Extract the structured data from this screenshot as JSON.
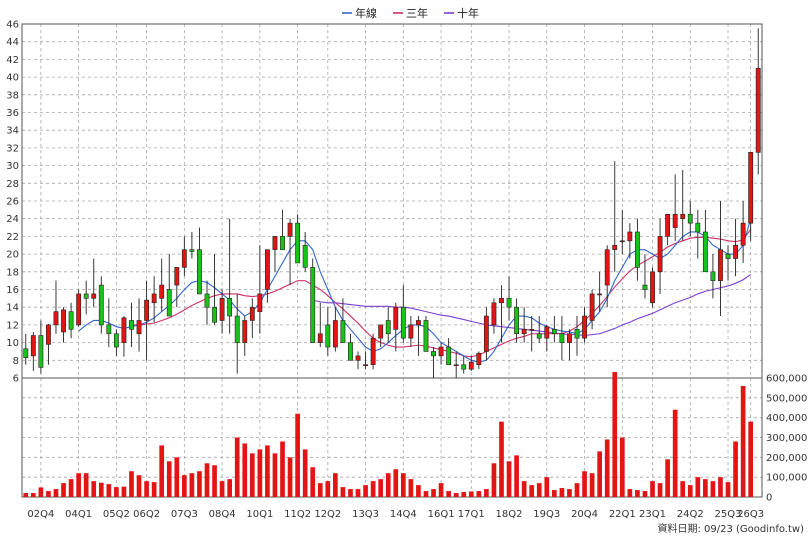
{
  "chart_data": {
    "type": "candlestick",
    "legend": [
      {
        "name": "年線",
        "color": "#3366cc"
      },
      {
        "name": "三年",
        "color": "#d0306a"
      },
      {
        "name": "十年",
        "color": "#7d3fcf"
      }
    ],
    "legend_position": "top-center",
    "grid": true,
    "up_color": "#e31414",
    "down_color": "#19c219",
    "volume_color": "#e31414",
    "price_axis": {
      "min": 6,
      "max": 46,
      "step": 2,
      "side": "left"
    },
    "volume_axis": {
      "min": 0,
      "max": 600000,
      "step": 100000,
      "side": "right",
      "tick_labels": [
        "0",
        "100,000",
        "200,000",
        "300,000",
        "400,000",
        "500,000",
        "600,000"
      ]
    },
    "x_ticks": [
      {
        "i": 2,
        "label": "02Q4"
      },
      {
        "i": 7,
        "label": "04Q1"
      },
      {
        "i": 12,
        "label": "05Q2"
      },
      {
        "i": 16,
        "label": "06Q2"
      },
      {
        "i": 21,
        "label": "07Q3"
      },
      {
        "i": 26,
        "label": "08Q4"
      },
      {
        "i": 31,
        "label": "10Q1"
      },
      {
        "i": 36,
        "label": "11Q2"
      },
      {
        "i": 40,
        "label": "12Q2"
      },
      {
        "i": 45,
        "label": "13Q3"
      },
      {
        "i": 50,
        "label": "14Q4"
      },
      {
        "i": 55,
        "label": "16Q1"
      },
      {
        "i": 59,
        "label": "17Q1"
      },
      {
        "i": 64,
        "label": "18Q2"
      },
      {
        "i": 69,
        "label": "19Q3"
      },
      {
        "i": 74,
        "label": "20Q4"
      },
      {
        "i": 79,
        "label": "22Q1"
      },
      {
        "i": 83,
        "label": "23Q1"
      },
      {
        "i": 88,
        "label": "24Q2"
      },
      {
        "i": 93,
        "label": "25Q3"
      },
      {
        "i": 96,
        "label": "26Q3"
      }
    ],
    "candles": [
      [
        9.3,
        11,
        7.5,
        8.3
      ],
      [
        8.5,
        11.2,
        6.8,
        10.8
      ],
      [
        10.8,
        12.5,
        6.5,
        7.2
      ],
      [
        9.8,
        12.1,
        7.5,
        12
      ],
      [
        12,
        17,
        11,
        13.5
      ],
      [
        11.2,
        14,
        10,
        13.7
      ],
      [
        13.5,
        14.5,
        10.5,
        11.5
      ],
      [
        12,
        16,
        11.8,
        15.5
      ],
      [
        15.5,
        17,
        13.2,
        15
      ],
      [
        15,
        19.5,
        14,
        15.5
      ],
      [
        16.5,
        17.5,
        11,
        12
      ],
      [
        12,
        15,
        9.5,
        11
      ],
      [
        11,
        11.5,
        8.5,
        9.5
      ],
      [
        10,
        13,
        8.4,
        12.8
      ],
      [
        12.5,
        14.5,
        9.5,
        11.5
      ],
      [
        11,
        15,
        9,
        12.5
      ],
      [
        12.5,
        17,
        8,
        14.8
      ],
      [
        14.5,
        17.5,
        12.3,
        15.5
      ],
      [
        15,
        19.5,
        13.5,
        16.5
      ],
      [
        16,
        20,
        13.5,
        13
      ],
      [
        16.5,
        17.5,
        14,
        18.5
      ],
      [
        18.5,
        22,
        17.5,
        20.5
      ],
      [
        20.5,
        22.5,
        19.5,
        20.3
      ],
      [
        20.5,
        23,
        16,
        15.5
      ],
      [
        15.5,
        17,
        12,
        14
      ],
      [
        14,
        20,
        12,
        12.3
      ],
      [
        12.5,
        16,
        11,
        15
      ],
      [
        15,
        24,
        11,
        13
      ],
      [
        13,
        15.5,
        6.5,
        10
      ],
      [
        10,
        13,
        8.5,
        12.5
      ],
      [
        12.5,
        15,
        10.5,
        14
      ],
      [
        13.5,
        21,
        11,
        15.5
      ],
      [
        16,
        19,
        14.5,
        20.5
      ],
      [
        20.5,
        22,
        18,
        22
      ],
      [
        22,
        25,
        20.5,
        20.5
      ],
      [
        22,
        24,
        16.5,
        23.5
      ],
      [
        23.5,
        24.5,
        21,
        19
      ],
      [
        21,
        22.5,
        18,
        18.5
      ],
      [
        18.5,
        19.5,
        10,
        10
      ],
      [
        10,
        14.5,
        9.5,
        11
      ],
      [
        12,
        14,
        8.5,
        9.5
      ],
      [
        9.5,
        14,
        9,
        12.5
      ],
      [
        12.5,
        15,
        10,
        10
      ],
      [
        10,
        11,
        8.5,
        8
      ],
      [
        8,
        9,
        7,
        8.5
      ],
      [
        7.5,
        9,
        7,
        7.5
      ],
      [
        7.5,
        11,
        7,
        10.5
      ],
      [
        10.5,
        12,
        9.5,
        12
      ],
      [
        12.5,
        14,
        10,
        11
      ],
      [
        11.5,
        14.5,
        9,
        14
      ],
      [
        14,
        16.5,
        10,
        10.5
      ],
      [
        10.5,
        13,
        9.5,
        12
      ],
      [
        12,
        13,
        8.5,
        12.5
      ],
      [
        12.5,
        13,
        9.5,
        9
      ],
      [
        9,
        9.5,
        6,
        8.5
      ],
      [
        8.5,
        10,
        7.5,
        9.5
      ],
      [
        9.5,
        10.5,
        8.5,
        7.5
      ],
      [
        7.5,
        9,
        6,
        7.5
      ],
      [
        7.5,
        8.5,
        6.5,
        7
      ],
      [
        7,
        8.5,
        6.8,
        7.8
      ],
      [
        7.5,
        9,
        7,
        8.8
      ],
      [
        9,
        14,
        8,
        13
      ],
      [
        12,
        15,
        11,
        14.5
      ],
      [
        14.5,
        16.5,
        10,
        15
      ],
      [
        15,
        17.5,
        12.5,
        14
      ],
      [
        14,
        15,
        10,
        11
      ],
      [
        11,
        14,
        10,
        11.5
      ],
      [
        11.5,
        13,
        9,
        11.5
      ],
      [
        11,
        13,
        10,
        10.5
      ],
      [
        10.5,
        12,
        9,
        11.8
      ],
      [
        11.5,
        13,
        10,
        11
      ],
      [
        11,
        13,
        8,
        10
      ],
      [
        10,
        11.5,
        8,
        11
      ],
      [
        11.5,
        13,
        8.5,
        10.5
      ],
      [
        10.5,
        14,
        10,
        13
      ],
      [
        12.5,
        16,
        11.5,
        15.5
      ],
      [
        15.5,
        18,
        13.5,
        15.5
      ],
      [
        16.5,
        21,
        14,
        20.5
      ],
      [
        20.5,
        30.5,
        18,
        21
      ],
      [
        21.5,
        25,
        20,
        21.5
      ],
      [
        21.5,
        23.5,
        19.5,
        22.5
      ],
      [
        22.5,
        24,
        17,
        18.5
      ],
      [
        16.5,
        20,
        15,
        16
      ],
      [
        14.5,
        18.5,
        14,
        18
      ],
      [
        18,
        24,
        15.5,
        22
      ],
      [
        22,
        24.5,
        21,
        24.5
      ],
      [
        23,
        29,
        21.5,
        24.5
      ],
      [
        24,
        29.5,
        21.5,
        24.5
      ],
      [
        24.5,
        26,
        22,
        23.5
      ],
      [
        23.5,
        25,
        19.5,
        22.5
      ],
      [
        22.5,
        25,
        19,
        18
      ],
      [
        18,
        20,
        15,
        17
      ],
      [
        17,
        26,
        13,
        20.5
      ],
      [
        20,
        21,
        17,
        19.5
      ],
      [
        19.5,
        24,
        17.5,
        21
      ],
      [
        21,
        26,
        19,
        23.5
      ],
      [
        23.5,
        30,
        21.5,
        31.5
      ],
      [
        31.5,
        45.5,
        29,
        41
      ]
    ],
    "volume": [
      20000,
      20000,
      48000,
      30000,
      40000,
      70000,
      90000,
      120000,
      120000,
      80000,
      72000,
      65000,
      50000,
      52000,
      130000,
      110000,
      80000,
      75000,
      260000,
      180000,
      200000,
      110000,
      120000,
      130000,
      170000,
      160000,
      80000,
      90000,
      300000,
      270000,
      220000,
      240000,
      260000,
      220000,
      280000,
      200000,
      420000,
      240000,
      150000,
      70000,
      80000,
      120000,
      50000,
      40000,
      40000,
      60000,
      80000,
      90000,
      120000,
      140000,
      120000,
      90000,
      60000,
      30000,
      40000,
      70000,
      30000,
      20000,
      25000,
      28000,
      30000,
      40000,
      170000,
      380000,
      180000,
      210000,
      80000,
      60000,
      70000,
      100000,
      35000,
      45000,
      40000,
      70000,
      130000,
      120000,
      230000,
      290000,
      630000,
      300000,
      40000,
      35000,
      30000,
      80000,
      70000,
      190000,
      440000,
      80000,
      60000,
      100000,
      90000,
      80000,
      100000,
      75000,
      280000,
      560000,
      380000
    ],
    "ma_year": [
      null,
      null,
      null,
      null,
      null,
      null,
      null,
      11.3,
      12,
      12.5,
      12.5,
      12.2,
      11.8,
      11.6,
      11.8,
      12,
      12.3,
      12.8,
      13.5,
      14.2,
      15,
      16,
      16.8,
      17,
      16.8,
      16.2,
      15.5,
      14.8,
      13.8,
      13,
      13.5,
      14.5,
      16,
      17.5,
      19,
      20.5,
      21.5,
      21.5,
      20.5,
      18,
      16,
      14,
      12.5,
      11.5,
      10.5,
      9.5,
      9,
      9.3,
      10,
      10.8,
      11.5,
      12,
      12,
      11.8,
      11,
      10,
      9.5,
      9,
      8.5,
      8,
      7.8,
      8,
      9,
      10.5,
      12,
      13,
      13,
      12.8,
      12.2,
      11.8,
      11.5,
      11.3,
      11.2,
      11,
      11.5,
      12.5,
      13.5,
      15,
      17,
      18.5,
      20,
      20.5,
      20.5,
      20,
      19.5,
      20,
      21,
      22,
      22.5,
      22.5,
      22,
      21,
      20.5,
      20,
      20,
      21,
      24
    ],
    "ma_three": [
      null,
      null,
      null,
      null,
      null,
      null,
      null,
      null,
      null,
      null,
      null,
      null,
      null,
      null,
      12,
      12,
      12.1,
      12.2,
      12.5,
      12.8,
      13.2,
      13.7,
      14.2,
      14.6,
      15,
      15.3,
      15.5,
      15.5,
      15.5,
      15.3,
      15.2,
      15.3,
      15.5,
      15.8,
      16.2,
      16.6,
      17,
      17,
      16.5,
      16,
      15.3,
      14.5,
      13.8,
      13,
      12.2,
      11.3,
      10.5,
      10,
      9.7,
      9.5,
      9.5,
      9.6,
      9.7,
      9.6,
      9.4,
      9.2,
      9,
      8.8,
      8.5,
      8.4,
      8.6,
      9,
      9.4,
      9.8,
      10.2,
      10.5,
      10.7,
      11,
      11,
      11,
      11,
      11,
      11.3,
      11.8,
      12.5,
      13.3,
      14.2,
      15.2,
      16.3,
      17.2,
      18.1,
      18.7,
      19.2,
      19.7,
      20.2,
      20.8,
      21.2,
      21.5,
      21.8,
      21.9,
      21.9,
      21.8,
      21.7,
      21.5,
      21.4,
      21.6,
      22.8
    ],
    "ma_ten": [
      null,
      null,
      null,
      null,
      null,
      null,
      null,
      null,
      null,
      null,
      null,
      null,
      null,
      null,
      null,
      null,
      null,
      null,
      null,
      null,
      null,
      null,
      null,
      null,
      null,
      null,
      null,
      null,
      null,
      null,
      null,
      null,
      null,
      null,
      null,
      null,
      null,
      null,
      14.8,
      14.6,
      14.5,
      14.5,
      14.4,
      14.3,
      14.2,
      14.1,
      14.1,
      14.1,
      14.1,
      14,
      14,
      13.9,
      13.7,
      13.5,
      13.3,
      13.1,
      13,
      12.8,
      12.6,
      12.4,
      12.2,
      12,
      11.9,
      11.8,
      11.7,
      11.6,
      11.5,
      11.4,
      11.3,
      11.2,
      11.1,
      11,
      10.9,
      10.9,
      10.8,
      10.9,
      11,
      11.3,
      11.6,
      12,
      12.3,
      12.7,
      13,
      13.3,
      13.7,
      14.1,
      14.5,
      14.8,
      15.1,
      15.5,
      15.8,
      16,
      16.2,
      16.4,
      16.7,
      17.1,
      17.7
    ]
  },
  "footer": {
    "source_label": "資料日期: 09/23 (Goodinfo.tw)"
  }
}
